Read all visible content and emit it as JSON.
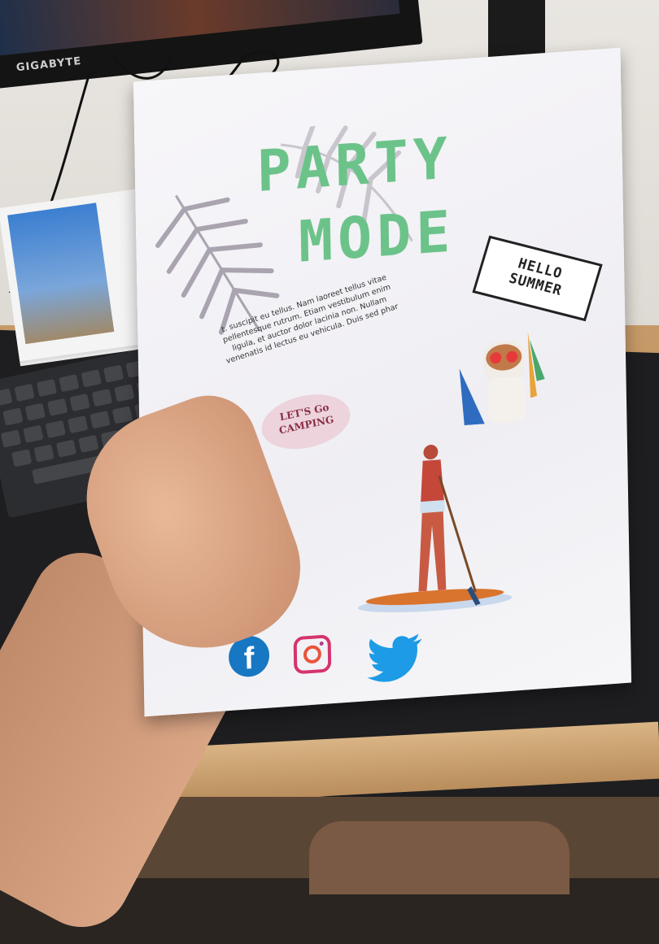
{
  "monitor": {
    "brand": "GIGABYTE"
  },
  "poster": {
    "title_line1": "PARTY",
    "title_line2": "MODE",
    "sign_line1": "HELLO",
    "sign_line2": "SUMMER",
    "body_text": "t. suscipit eu tellus. Nam laoreet tellus vitae pellentesque rutrum. Etiam vestibulum enim ligula, et auctor dolor lacinia non. Nullam venenatis id lectus eu vehicula. Duis sed phar",
    "bubble_line1": "LET'S Go",
    "bubble_line2": "CAMPING",
    "facebook_glyph": "f"
  },
  "colors": {
    "title_green": "#6cc38a",
    "facebook_blue": "#1877c2",
    "twitter_blue": "#1d9be6",
    "bubble_pink": "#ecd3dc"
  },
  "icons": [
    "facebook-icon",
    "instagram-icon",
    "twitter-icon",
    "palm-leaf-icon",
    "dog-icon",
    "paddleboard-person-icon"
  ]
}
